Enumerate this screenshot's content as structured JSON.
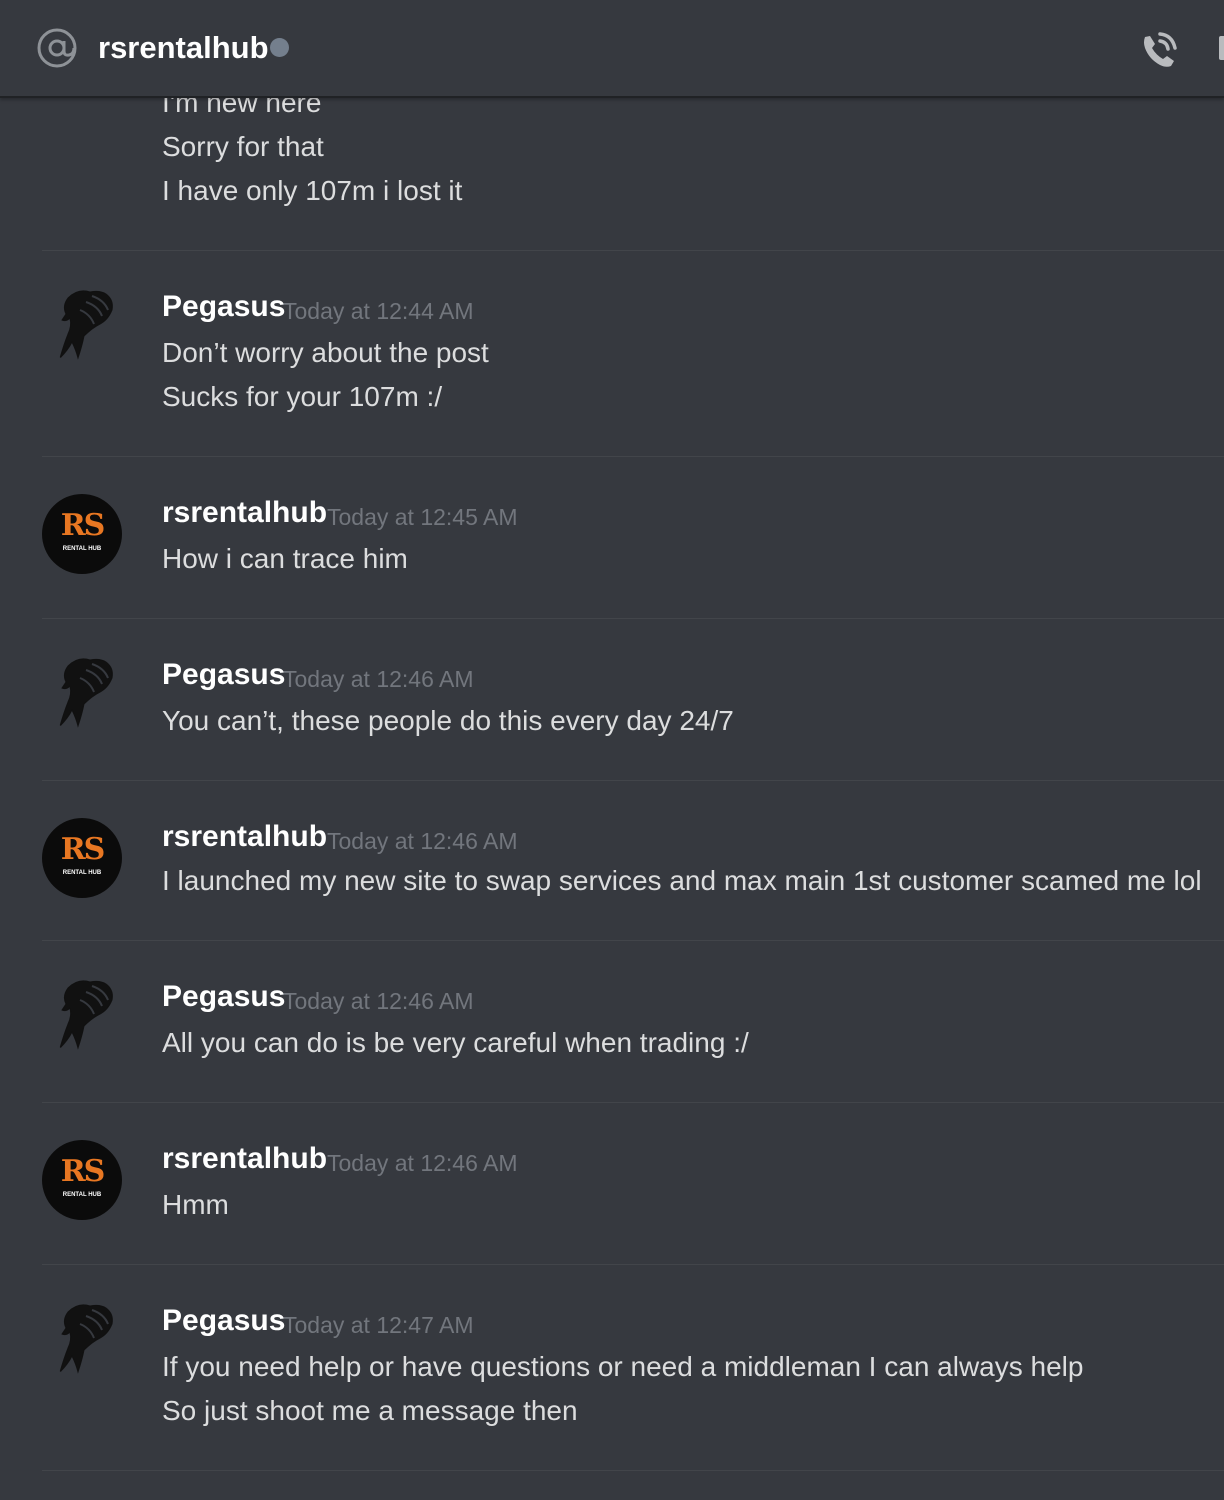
{
  "header": {
    "title": "rsrentalhub",
    "status": "offline",
    "icons": [
      "at-icon",
      "call-icon"
    ]
  },
  "messages": [
    {
      "author": "",
      "time": "",
      "lines": [
        "I'm new here",
        "Sorry for that",
        "I have only 107m i lost it"
      ]
    },
    {
      "author": "Pegasus",
      "time": "Today at 12:44 AM",
      "avatar": "pegasus-avatar",
      "lines": [
        "Don’t worry about the post",
        "Sucks for your 107m :/"
      ]
    },
    {
      "author": "rsrentalhub",
      "time": "Today at 12:45 AM",
      "avatar": "rsrentalhub-avatar",
      "lines": [
        "How i can trace him"
      ]
    },
    {
      "author": "Pegasus",
      "time": "Today at 12:46 AM",
      "avatar": "pegasus-avatar",
      "lines": [
        "You can’t, these people do this every day 24/7"
      ]
    },
    {
      "author": "rsrentalhub",
      "time": "Today at 12:46 AM",
      "avatar": "rsrentalhub-avatar",
      "lines": [
        "I launched my new site to swap services and max main 1st customer scamed me lol"
      ]
    },
    {
      "author": "Pegasus",
      "time": "Today at 12:46 AM",
      "avatar": "pegasus-avatar",
      "lines": [
        "All you can do is be very careful when trading :/"
      ]
    },
    {
      "author": "rsrentalhub",
      "time": "Today at 12:46 AM",
      "avatar": "rsrentalhub-avatar",
      "lines": [
        "Hmm"
      ]
    },
    {
      "author": "Pegasus",
      "time": "Today at 12:47 AM",
      "avatar": "pegasus-avatar",
      "lines": [
        "If you need help or have questions or need a middleman I can always help",
        "So just shoot me a message then"
      ]
    }
  ],
  "avatar_logo": {
    "mark": "RS",
    "caption": "RENTAL HUB",
    "mark_color": "#e87722"
  },
  "colors": {
    "background": "#36393f",
    "author": "#ffffff",
    "message_text": "#dcddde",
    "timestamp": "#72767d",
    "status_offline": "#747f8d"
  }
}
